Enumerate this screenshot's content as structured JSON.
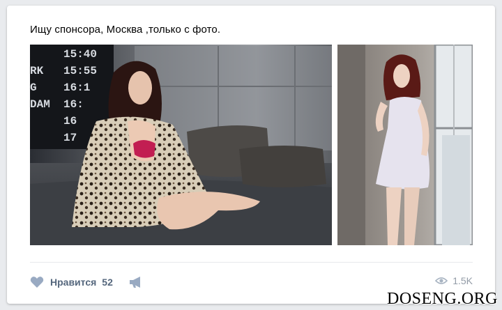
{
  "post": {
    "text": "Ищу спонсора, Москва ,только с фото."
  },
  "photos": [
    {
      "icon": "photo-woman-on-bed-with-flip-clock"
    },
    {
      "icon": "photo-woman-in-white-dress-by-window"
    }
  ],
  "board": {
    "times": [
      "15:40",
      "15:55",
      "16:1",
      "16:",
      "16",
      "17"
    ],
    "codes": [
      "RK",
      "G",
      "DAM"
    ]
  },
  "actions": {
    "like_label": "Нравится",
    "like_count": "52",
    "like_icon": "heart-icon",
    "share_icon": "megaphone-icon",
    "views_icon": "eye-icon",
    "views_count": "1.5K"
  },
  "watermark": "DOSENG.ORG",
  "colors": {
    "background": "#e9ebee",
    "card": "#ffffff",
    "action_text": "#55677d",
    "icon": "#99aac2",
    "views_text": "#939ca7"
  }
}
